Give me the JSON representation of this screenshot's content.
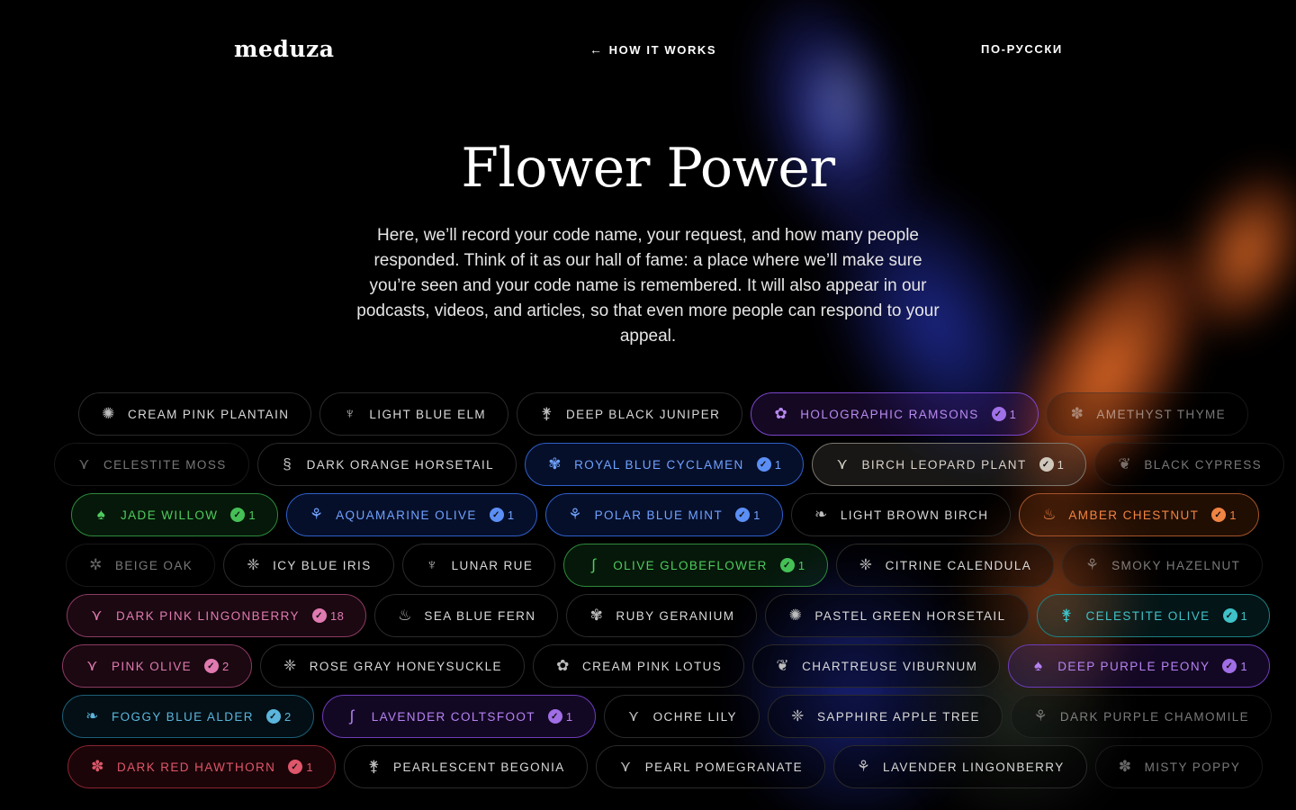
{
  "header": {
    "logo": "meduza",
    "how_it_works": "HOW IT WORKS",
    "language": "ПО-РУССКИ"
  },
  "hero": {
    "title": "Flower Power",
    "intro": "Here, we’ll record your code name, your request, and how many people responded. Think of it as our hall of fame: a place where we’ll make sure you’re seen and your code name is remembered. It will also appear in our podcasts, videos, and articles, so that even more people can respond to your appeal."
  },
  "rows": [
    [
      {
        "label": "CREAM PINK PLANTAIN",
        "icon": "plantain-icon",
        "glyph": "✺"
      },
      {
        "label": "LIGHT BLUE ELM",
        "icon": "grass-icon",
        "glyph": "♆"
      },
      {
        "label": "DEEP BLACK JUNIPER",
        "icon": "juniper-icon",
        "glyph": "⚵"
      },
      {
        "label": "HOLOGRAPHIC RAMSONS",
        "icon": "ramsons-icon",
        "glyph": "✿",
        "color": "purple",
        "count": "1"
      },
      {
        "label": "AMETHYST THYME",
        "icon": "thyme-icon",
        "glyph": "✽",
        "dim": true
      }
    ],
    [
      {
        "label": "CELESTITE MOSS",
        "icon": "moss-icon",
        "glyph": "⋎",
        "dim": true
      },
      {
        "label": "DARK ORANGE HORSETAIL",
        "icon": "horsetail-icon",
        "glyph": "§"
      },
      {
        "label": "ROYAL BLUE CYCLAMEN",
        "icon": "cyclamen-icon",
        "glyph": "✾",
        "color": "blue",
        "count": "1"
      },
      {
        "label": "BIRCH LEOPARD PLANT",
        "icon": "leopard-plant-icon",
        "glyph": "⋎",
        "color": "gray",
        "count": "1"
      },
      {
        "label": "BLACK CYPRESS",
        "icon": "cypress-icon",
        "glyph": "❦",
        "dim": true
      }
    ],
    [
      {
        "label": "JADE WILLOW",
        "icon": "willow-icon",
        "glyph": "♠",
        "color": "green",
        "count": "1"
      },
      {
        "label": "AQUAMARINE OLIVE",
        "icon": "olive-icon",
        "glyph": "⚘",
        "color": "blue",
        "count": "1"
      },
      {
        "label": "POLAR BLUE MINT",
        "icon": "mint-icon",
        "glyph": "⚘",
        "color": "blue",
        "count": "1"
      },
      {
        "label": "LIGHT BROWN BIRCH",
        "icon": "birch-icon",
        "glyph": "❧"
      },
      {
        "label": "AMBER CHESTNUT",
        "icon": "chestnut-icon",
        "glyph": "♨",
        "color": "orange",
        "count": "1"
      }
    ],
    [
      {
        "label": "BEIGE OAK",
        "icon": "oak-icon",
        "glyph": "✲",
        "dim": true
      },
      {
        "label": "ICY BLUE IRIS",
        "icon": "iris-icon",
        "glyph": "❈"
      },
      {
        "label": "LUNAR RUE",
        "icon": "rue-icon",
        "glyph": "♆"
      },
      {
        "label": "OLIVE GLOBEFLOWER",
        "icon": "globeflower-icon",
        "glyph": "∫",
        "color": "green",
        "count": "1"
      },
      {
        "label": "CITRINE CALENDULA",
        "icon": "calendula-icon",
        "glyph": "❈"
      },
      {
        "label": "SMOKY HAZELNUT",
        "icon": "hazelnut-icon",
        "glyph": "⚘",
        "dim": true
      }
    ],
    [
      {
        "label": "DARK PINK LINGONBERRY",
        "icon": "lingonberry-icon",
        "glyph": "⋎",
        "color": "pink",
        "count": "18"
      },
      {
        "label": "SEA BLUE FERN",
        "icon": "fern-icon",
        "glyph": "♨"
      },
      {
        "label": "RUBY GERANIUM",
        "icon": "geranium-icon",
        "glyph": "✾"
      },
      {
        "label": "PASTEL GREEN HORSETAIL",
        "icon": "horsetail-icon",
        "glyph": "✺"
      },
      {
        "label": "CELESTITE OLIVE",
        "icon": "olive-icon",
        "glyph": "⚵",
        "color": "teal",
        "count": "1"
      }
    ],
    [
      {
        "label": "PINK OLIVE",
        "icon": "olive-icon",
        "glyph": "⋎",
        "color": "pink",
        "count": "2"
      },
      {
        "label": "ROSE GRAY HONEYSUCKLE",
        "icon": "honeysuckle-icon",
        "glyph": "❈"
      },
      {
        "label": "CREAM PINK LOTUS",
        "icon": "lotus-icon",
        "glyph": "✿"
      },
      {
        "label": "CHARTREUSE VIBURNUM",
        "icon": "viburnum-icon",
        "glyph": "❦"
      },
      {
        "label": "DEEP PURPLE PEONY",
        "icon": "peony-icon",
        "glyph": "♠",
        "color": "violet",
        "count": "1"
      }
    ],
    [
      {
        "label": "FOGGY BLUE ALDER",
        "icon": "alder-icon",
        "glyph": "❧",
        "color": "sky",
        "count": "2"
      },
      {
        "label": "LAVENDER COLTSFOOT",
        "icon": "coltsfoot-icon",
        "glyph": "∫",
        "color": "violet",
        "count": "1"
      },
      {
        "label": "OCHRE LILY",
        "icon": "lily-icon",
        "glyph": "⋎"
      },
      {
        "label": "SAPPHIRE APPLE TREE",
        "icon": "apple-tree-icon",
        "glyph": "❈"
      },
      {
        "label": "DARK PURPLE CHAMOMILE",
        "icon": "chamomile-icon",
        "glyph": "⚘",
        "dim": true
      }
    ],
    [
      {
        "label": "DARK RED HAWTHORN",
        "icon": "hawthorn-icon",
        "glyph": "✽",
        "color": "red",
        "count": "1"
      },
      {
        "label": "PEARLESCENT BEGONIA",
        "icon": "begonia-icon",
        "glyph": "⚵"
      },
      {
        "label": "PEARL POMEGRANATE",
        "icon": "pomegranate-icon",
        "glyph": "⋎"
      },
      {
        "label": "LAVENDER LINGONBERRY",
        "icon": "lingonberry-icon",
        "glyph": "⚘"
      },
      {
        "label": "MISTY POPPY",
        "icon": "poppy-icon",
        "glyph": "✽",
        "dim": true
      }
    ]
  ]
}
